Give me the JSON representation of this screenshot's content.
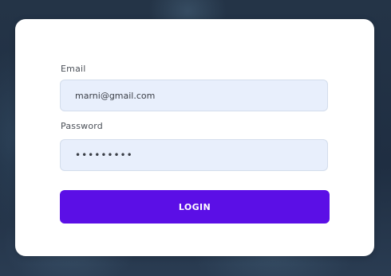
{
  "form": {
    "email_label": "Email",
    "email_value": "marni@gmail.com",
    "password_label": "Password",
    "password_value": "•••••••••",
    "login_label": "LOGIN"
  },
  "colors": {
    "accent": "#5b0fe6",
    "input_background": "#e8effc",
    "page_background": "#223246"
  }
}
